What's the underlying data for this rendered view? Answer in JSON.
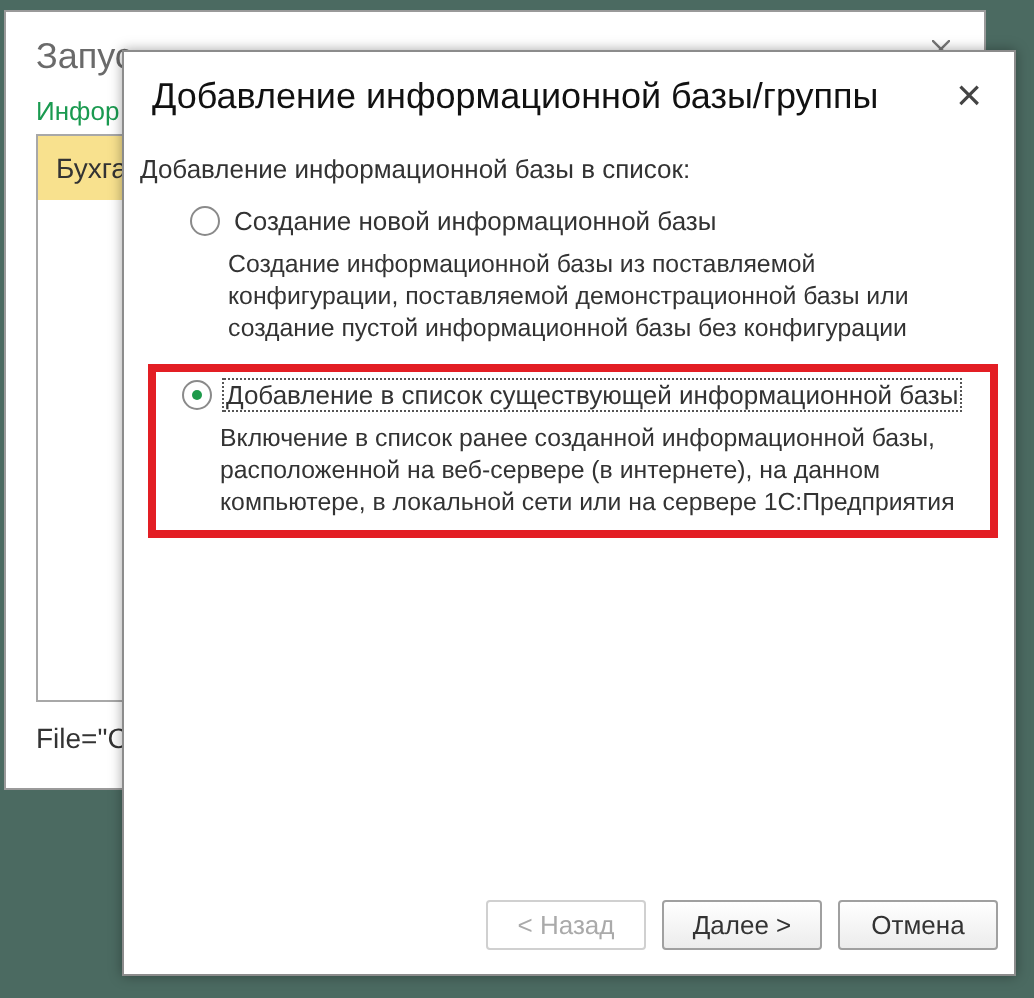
{
  "back_window": {
    "title": "Запус",
    "list_label": "Инфор",
    "rows": [
      {
        "label": "Бухга",
        "selected": true
      }
    ],
    "path_text": "File=\"C"
  },
  "dialog": {
    "title": "Добавление информационной базы/группы",
    "close": "×",
    "prompt": "Добавление информационной базы в список:",
    "options": [
      {
        "label": "Создание новой информационной базы",
        "description": "Создание информационной базы из поставляемой конфигурации, поставляемой демонстрационной базы или создание пустой информационной базы без конфигурации",
        "selected": false,
        "highlighted": false
      },
      {
        "label": "Добавление в список существующей информационной базы",
        "description": "Включение в список ранее созданной информационной базы, расположенной на веб-сервере (в интернете), на данном компьютере, в локальной сети или на сервере 1С:Предприятия",
        "selected": true,
        "highlighted": true
      }
    ],
    "buttons": [
      {
        "label": "< Назад",
        "disabled": true
      },
      {
        "label": "Далее >",
        "disabled": false
      },
      {
        "label": "Отмена",
        "disabled": false
      }
    ]
  }
}
